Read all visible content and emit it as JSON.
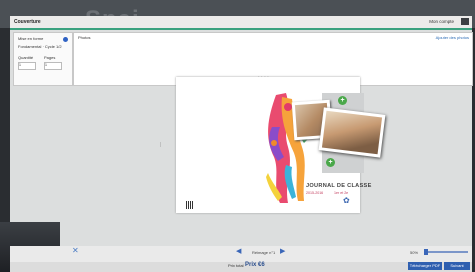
{
  "background_title": "Spaj",
  "header": {
    "title": "Couverture",
    "account": "Mon compte"
  },
  "left_panel": {
    "row1": "Mise en forme",
    "row2": "Fondamental · Cycle 1/2",
    "quantity_label": "Quantité",
    "quantity_value": "1",
    "pages_label": "Pages",
    "pages_value": "1"
  },
  "photos_panel": {
    "label": "Photos",
    "link": "Ajouter des photos"
  },
  "book": {
    "title": "JOURNAL DE CLASSE",
    "years": "2015-2016",
    "subtitle": "1er et 2e",
    "plus": "+",
    "logo_glyph": "✿"
  },
  "toolbar": {
    "close": "✕",
    "prev": "◀",
    "next": "▶",
    "page_label": "Réimage n°1",
    "zoom_min": "50%"
  },
  "footer": {
    "price_label": "Prix total",
    "price": "Prix €6",
    "download_button": "Télécharger PDF",
    "next_button": "Suivant"
  },
  "colors": {
    "accent": "#3aa17e",
    "link": "#2c6bb5",
    "button": "#2f5fb0"
  }
}
